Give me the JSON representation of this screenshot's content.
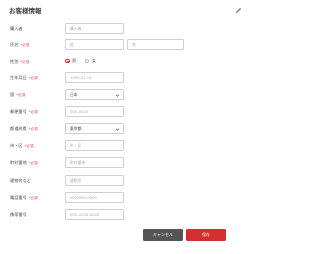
{
  "form": {
    "title": "お客様情報",
    "required_mark": "*必須",
    "fields": {
      "name": {
        "label": "購入者",
        "placeholder": "購入者"
      },
      "fullname": {
        "label": "氏名",
        "last_placeholder": "姓",
        "first_placeholder": "名"
      },
      "gender": {
        "label": "性別",
        "options": [
          "男",
          "女"
        ],
        "selected": "男"
      },
      "birthday": {
        "label": "生年月日",
        "placeholder": "1990-01-01"
      },
      "country": {
        "label": "国",
        "value": "日本"
      },
      "zipcode": {
        "label": "郵便番号",
        "placeholder": "000-0000"
      },
      "prefecture": {
        "label": "都道府県",
        "value": "東京都"
      },
      "city": {
        "label": "市・区",
        "placeholder": "市・区"
      },
      "address": {
        "label": "町村番地",
        "placeholder": "町村番地"
      },
      "building": {
        "label": "建物名など",
        "placeholder": "建物名"
      },
      "phone": {
        "label": "電話番号",
        "placeholder": "00-0000-0000"
      },
      "mobile": {
        "label": "携帯番号",
        "placeholder": "000-0000-0000"
      }
    },
    "buttons": {
      "cancel": "キャンセル",
      "save": "保存"
    }
  },
  "colors": {
    "accent": "#d32f2f",
    "cancel": "#555555",
    "border": "#cfcfcf"
  },
  "icons": {
    "edit": "pencil-icon",
    "select": "chevron-down-icon"
  }
}
